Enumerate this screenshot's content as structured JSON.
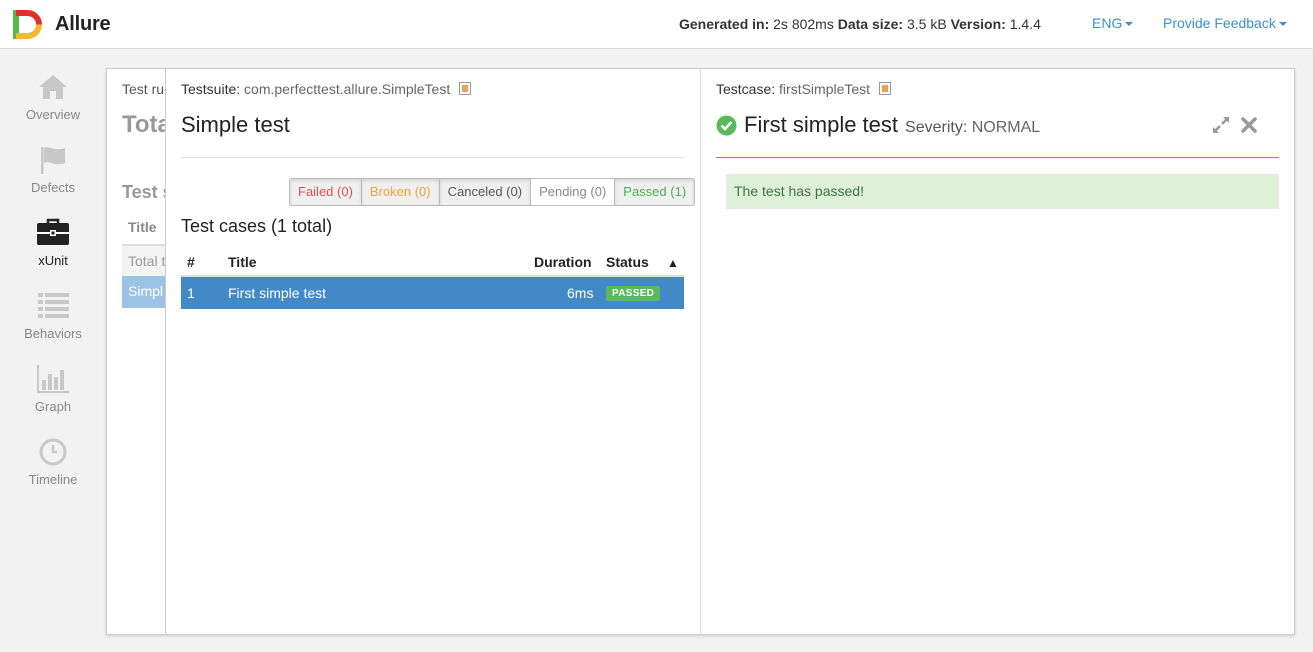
{
  "header": {
    "app_name": "Allure",
    "generated_label": "Generated in:",
    "generated_value": "2s 802ms",
    "datasize_label": "Data size:",
    "datasize_value": "3.5 kB",
    "version_label": "Version:",
    "version_value": "1.4.4",
    "language": "ENG",
    "feedback": "Provide Feedback",
    "colors": {
      "logo_red": "#e0302b",
      "logo_yellow": "#f4b92b",
      "logo_green": "#58b947",
      "link": "#3a8fd4"
    }
  },
  "sidebar": {
    "items": [
      {
        "label": "Overview",
        "icon": "home-icon",
        "active": false
      },
      {
        "label": "Defects",
        "icon": "flag-icon",
        "active": false
      },
      {
        "label": "xUnit",
        "icon": "briefcase-icon",
        "active": true
      },
      {
        "label": "Behaviors",
        "icon": "list-icon",
        "active": false
      },
      {
        "label": "Graph",
        "icon": "bar-chart-icon",
        "active": false
      },
      {
        "label": "Timeline",
        "icon": "clock-icon",
        "active": false
      }
    ]
  },
  "testruns_pane": {
    "label": "Test ru",
    "total": "Tota",
    "subtitle": "Test s",
    "col_title": "Title",
    "row_total": "Total t",
    "row_selected": "Simpl"
  },
  "suite_pane": {
    "crumb_label": "Testsuite:",
    "crumb_value": "com.perfecttest.allure.SimpleTest",
    "title": "Simple test",
    "filters": [
      {
        "label": "Failed (0)",
        "kind": "failed"
      },
      {
        "label": "Broken (0)",
        "kind": "broken"
      },
      {
        "label": "Canceled (0)",
        "kind": "canceled"
      },
      {
        "label": "Pending (0)",
        "kind": "pending"
      },
      {
        "label": "Passed (1)",
        "kind": "passed"
      }
    ],
    "cases_heading": "Test cases (1 total)",
    "columns": {
      "num": "#",
      "title": "Title",
      "duration": "Duration",
      "status": "Status",
      "sort_icon": "▲"
    },
    "rows": [
      {
        "num": "1",
        "title": "First simple test",
        "duration": "6ms",
        "status": "PASSED"
      }
    ]
  },
  "case_pane": {
    "crumb_label": "Testcase:",
    "crumb_value": "firstSimpleTest",
    "title": "First simple test",
    "severity_label": "Severity:",
    "severity_value": "NORMAL",
    "message": "The test has passed!",
    "status_color": "#5cb85c"
  }
}
